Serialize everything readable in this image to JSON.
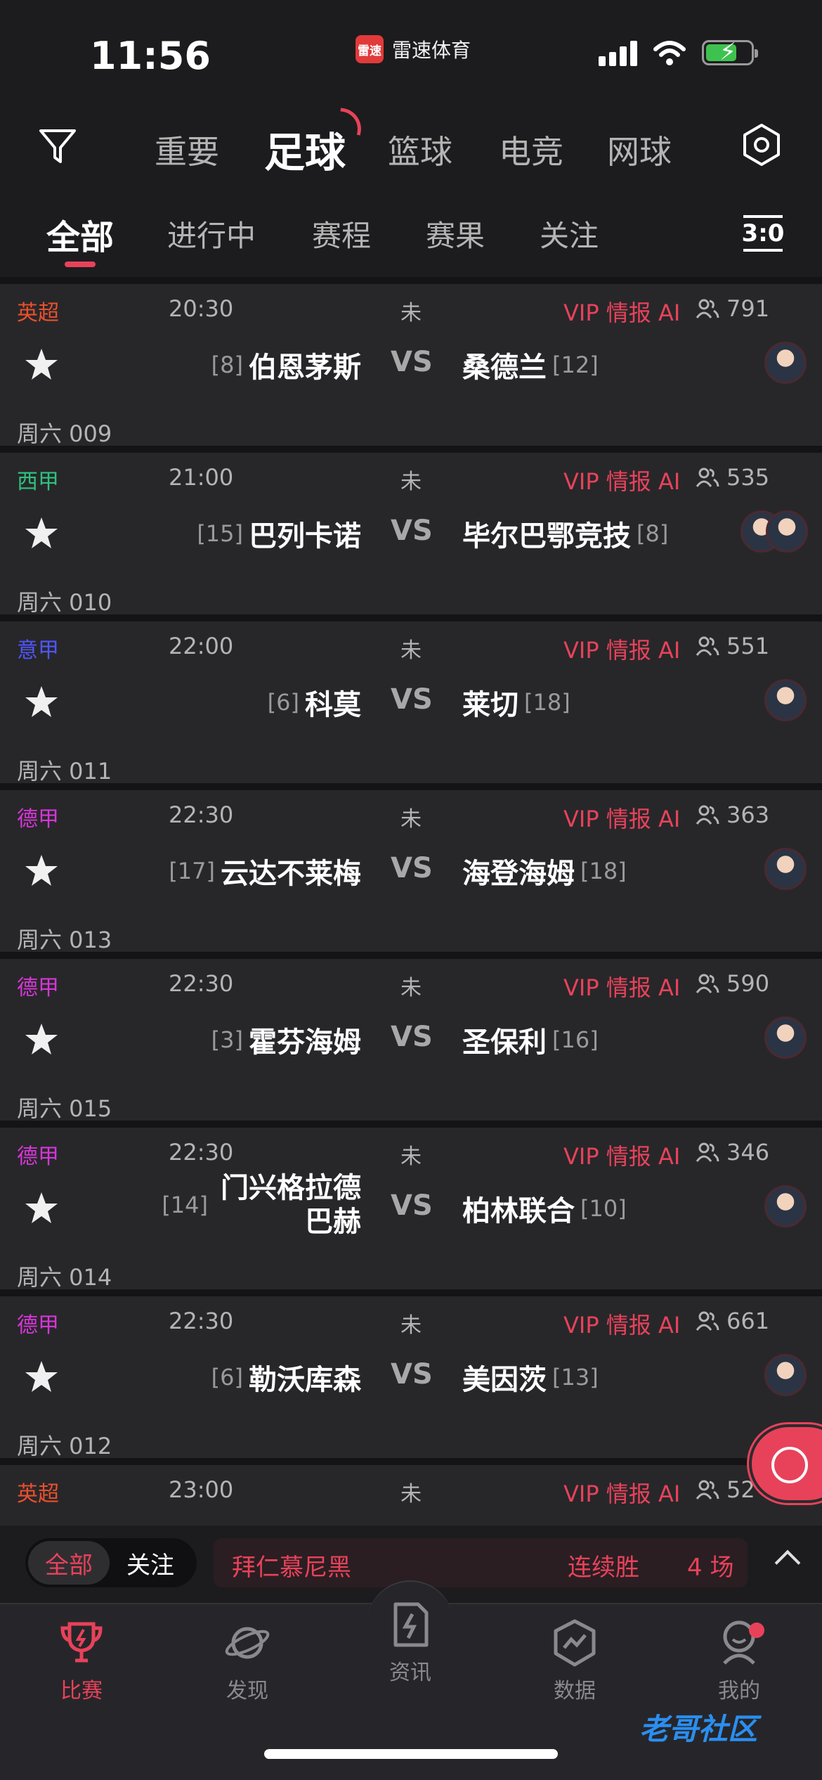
{
  "status_bar": {
    "time": "11:56",
    "app_name": "雷速体育",
    "app_logo_text": "雷速"
  },
  "sport_tabs": [
    "重要",
    "足球",
    "篮球",
    "电竞",
    "网球"
  ],
  "filter_tabs": [
    "全部",
    "进行中",
    "赛程",
    "赛果",
    "关注"
  ],
  "score_icon_text": "3:0",
  "league_colors": {
    "英超": "#e8502c",
    "西甲": "#2ec27e",
    "意甲": "#5056ff",
    "德甲": "#d636d6"
  },
  "matches": [
    {
      "league": "英超",
      "time": "20:30",
      "status": "未",
      "vip": "VIP 情报 AI",
      "viewers": "791",
      "home_rank": "[8]",
      "home": "伯恩茅斯",
      "vs": "VS",
      "away": "桑德兰",
      "away_rank": "[12]",
      "match_no": "周六 009"
    },
    {
      "league": "西甲",
      "time": "21:00",
      "status": "未",
      "vip": "VIP 情报 AI",
      "viewers": "535",
      "home_rank": "[15]",
      "home": "巴列卡诺",
      "vs": "VS",
      "away": "毕尔巴鄂竞技",
      "away_rank": "[8]",
      "match_no": "周六 010"
    },
    {
      "league": "意甲",
      "time": "22:00",
      "status": "未",
      "vip": "VIP 情报 AI",
      "viewers": "551",
      "home_rank": "[6]",
      "home": "科莫",
      "vs": "VS",
      "away": "莱切",
      "away_rank": "[18]",
      "match_no": "周六 011"
    },
    {
      "league": "德甲",
      "time": "22:30",
      "status": "未",
      "vip": "VIP 情报 AI",
      "viewers": "363",
      "home_rank": "[17]",
      "home": "云达不莱梅",
      "vs": "VS",
      "away": "海登海姆",
      "away_rank": "[18]",
      "match_no": "周六 013"
    },
    {
      "league": "德甲",
      "time": "22:30",
      "status": "未",
      "vip": "VIP 情报 AI",
      "viewers": "590",
      "home_rank": "[3]",
      "home": "霍芬海姆",
      "vs": "VS",
      "away": "圣保利",
      "away_rank": "[16]",
      "match_no": "周六 015"
    },
    {
      "league": "德甲",
      "time": "22:30",
      "status": "未",
      "vip": "VIP 情报 AI",
      "viewers": "346",
      "home_rank": "[14]",
      "home": "门兴格拉德巴赫",
      "vs": "VS",
      "away": "柏林联合",
      "away_rank": "[10]",
      "match_no": "周六 014"
    },
    {
      "league": "德甲",
      "time": "22:30",
      "status": "未",
      "vip": "VIP 情报 AI",
      "viewers": "661",
      "home_rank": "[6]",
      "home": "勒沃库森",
      "vs": "VS",
      "away": "美因茨",
      "away_rank": "[13]",
      "match_no": "周六 012"
    },
    {
      "league": "英超",
      "time": "23:00",
      "status": "未",
      "vip": "VIP 情报 AI",
      "viewers": "52",
      "home_rank": "",
      "home": "",
      "vs": "",
      "away": "",
      "away_rank": "",
      "match_no": ""
    }
  ],
  "bottom_strip": {
    "toggle_all": "全部",
    "toggle_follow": "关注",
    "streak_team": "拜仁慕尼黑",
    "streak_type": "连续胜",
    "streak_count": "4 场"
  },
  "tab_bar": [
    "比赛",
    "发现",
    "资讯",
    "数据",
    "我的"
  ],
  "watermark": "老哥社区",
  "accent_color": "#e8425a"
}
